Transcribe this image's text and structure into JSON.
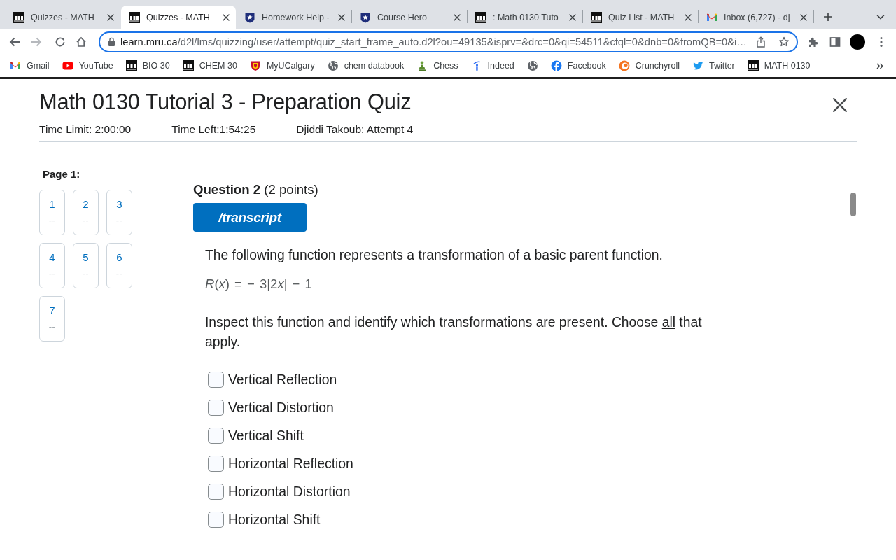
{
  "browser": {
    "tabs": [
      {
        "kind": "d2l",
        "title": "Quizzes - MATH",
        "selected": false
      },
      {
        "kind": "d2l",
        "title": "Quizzes - MATH",
        "selected": true
      },
      {
        "kind": "starshield",
        "title": "Homework Help -",
        "selected": false
      },
      {
        "kind": "starshield",
        "title": "Course Hero",
        "selected": false
      },
      {
        "kind": "d2l",
        "title": ": Math 0130 Tuto",
        "selected": false
      },
      {
        "kind": "d2l",
        "title": "Quiz List - MATH",
        "selected": false
      },
      {
        "kind": "mail",
        "title": "Inbox (6,727) - dj",
        "selected": false
      }
    ],
    "address_bar": {
      "host": "learn.mru.ca",
      "path": "/d2l/lms/quizzing/user/attempt/quiz_start_frame_auto.d2l?ou=49135&isprv=&drc=0&qi=54511&cfql=0&dnb=0&fromQB=0&i…"
    },
    "bookmarks": [
      {
        "kind": "mail",
        "label": "Gmail"
      },
      {
        "kind": "play",
        "label": "YouTube"
      },
      {
        "kind": "d2l",
        "label": "BIO 30"
      },
      {
        "kind": "d2l",
        "label": "CHEM 30"
      },
      {
        "kind": "crest",
        "label": "MyUCalgary"
      },
      {
        "kind": "globe",
        "label": "chem databook"
      },
      {
        "kind": "pawn",
        "label": "Chess"
      },
      {
        "kind": "ilogo",
        "label": "Indeed"
      },
      {
        "kind": "globe"
      },
      {
        "kind": "flogo",
        "label": "Facebook"
      },
      {
        "kind": "ring",
        "label": "Crunchyroll"
      },
      {
        "kind": "bird",
        "label": "Twitter"
      },
      {
        "kind": "d2l",
        "label": "MATH 0130"
      }
    ]
  },
  "quiz": {
    "title": "Math 0130 Tutorial 3 - Preparation Quiz",
    "time_limit": "Time Limit: 2:00:00",
    "time_left": "Time Left:1:54:25",
    "attempt": "Djiddi Takoub: Attempt 4"
  },
  "page_nav": {
    "label": "Page 1:",
    "questions": [
      {
        "number": "1",
        "status": "--"
      },
      {
        "number": "2",
        "status": "--"
      },
      {
        "number": "3",
        "status": "--"
      },
      {
        "number": "4",
        "status": "--"
      },
      {
        "number": "5",
        "status": "--"
      },
      {
        "number": "6",
        "status": "--"
      },
      {
        "number": "7",
        "status": "--"
      }
    ]
  },
  "question": {
    "heading": "**Question 2** (2 points)",
    "transcript_button": "/transcript",
    "prompt": "The following function represents a transformation of a basic parent function.",
    "formula": [
      {
        "kind": "var",
        "text": "R"
      },
      {
        "kind": "plain",
        "text": "("
      },
      {
        "kind": "var",
        "text": "x"
      },
      {
        "kind": "plain",
        "text": ") = − 3|2"
      },
      {
        "kind": "var",
        "text": "x"
      },
      {
        "kind": "plain",
        "text": "| − 1"
      }
    ],
    "instruction": {
      "before": "Inspect this function and identify which transformations are present. Choose ",
      "underlined": "all",
      "after": " that apply."
    },
    "options": [
      {
        "label": "Vertical Reflection",
        "checked": false
      },
      {
        "label": "Vertical Distortion",
        "checked": false
      },
      {
        "label": "Vertical Shift",
        "checked": false
      },
      {
        "label": "Horizontal Reflection",
        "checked": false
      },
      {
        "label": "Horizontal Distortion",
        "checked": false
      },
      {
        "label": "Horizontal Shift",
        "checked": false
      }
    ]
  }
}
